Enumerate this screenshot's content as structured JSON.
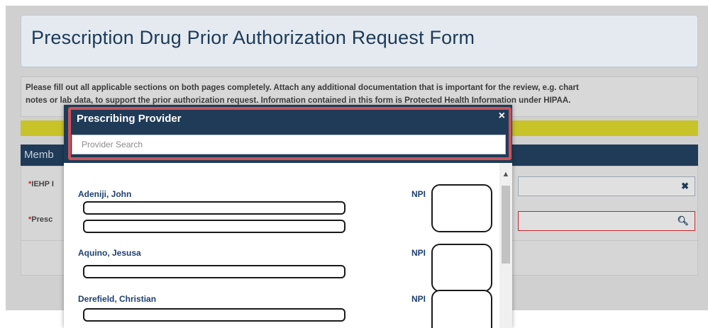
{
  "form": {
    "title": "Prescription Drug Prior Authorization Request Form",
    "instructions_line1": "Please fill out all applicable sections on both pages completely. Attach any additional documentation that is important for the review, e.g. chart",
    "instructions_line2": "notes or lab data, to support the prior authorization request. Information contained in this form is Protected Health Information under HIPAA.",
    "section_header": "Memb",
    "field1_label": "IEHP I",
    "field2_label": "Presc",
    "required_mark": "*"
  },
  "modal": {
    "title": "Prescribing Provider",
    "close": "×",
    "search_placeholder": "Provider Search",
    "npi_label": "NPI",
    "providers": [
      {
        "name": "Adeniji, John"
      },
      {
        "name": "Aquino, Jesusa"
      },
      {
        "name": "Derefield, Christian"
      }
    ]
  },
  "icons": {
    "clear": "times-icon",
    "search": "search-icon",
    "scroll_up": "chevron-up-icon"
  },
  "colors": {
    "navy": "#203b58",
    "highlight_red": "#c8545a",
    "yellow": "#c9c32a",
    "link_blue": "#1d3f6e"
  }
}
